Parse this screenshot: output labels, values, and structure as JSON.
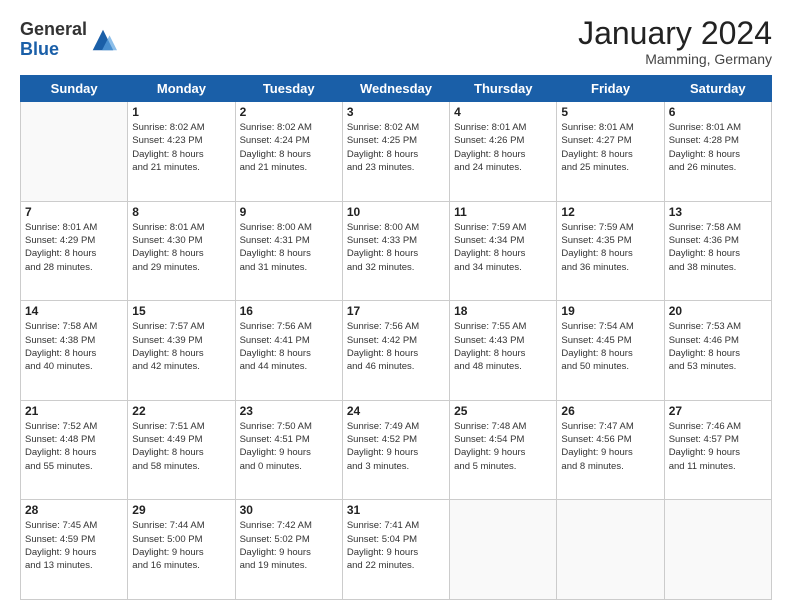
{
  "header": {
    "logo_general": "General",
    "logo_blue": "Blue",
    "month_title": "January 2024",
    "location": "Mamming, Germany"
  },
  "days_of_week": [
    "Sunday",
    "Monday",
    "Tuesday",
    "Wednesday",
    "Thursday",
    "Friday",
    "Saturday"
  ],
  "weeks": [
    [
      {
        "day": "",
        "info": ""
      },
      {
        "day": "1",
        "info": "Sunrise: 8:02 AM\nSunset: 4:23 PM\nDaylight: 8 hours\nand 21 minutes."
      },
      {
        "day": "2",
        "info": "Sunrise: 8:02 AM\nSunset: 4:24 PM\nDaylight: 8 hours\nand 21 minutes."
      },
      {
        "day": "3",
        "info": "Sunrise: 8:02 AM\nSunset: 4:25 PM\nDaylight: 8 hours\nand 23 minutes."
      },
      {
        "day": "4",
        "info": "Sunrise: 8:01 AM\nSunset: 4:26 PM\nDaylight: 8 hours\nand 24 minutes."
      },
      {
        "day": "5",
        "info": "Sunrise: 8:01 AM\nSunset: 4:27 PM\nDaylight: 8 hours\nand 25 minutes."
      },
      {
        "day": "6",
        "info": "Sunrise: 8:01 AM\nSunset: 4:28 PM\nDaylight: 8 hours\nand 26 minutes."
      }
    ],
    [
      {
        "day": "7",
        "info": "Sunrise: 8:01 AM\nSunset: 4:29 PM\nDaylight: 8 hours\nand 28 minutes."
      },
      {
        "day": "8",
        "info": "Sunrise: 8:01 AM\nSunset: 4:30 PM\nDaylight: 8 hours\nand 29 minutes."
      },
      {
        "day": "9",
        "info": "Sunrise: 8:00 AM\nSunset: 4:31 PM\nDaylight: 8 hours\nand 31 minutes."
      },
      {
        "day": "10",
        "info": "Sunrise: 8:00 AM\nSunset: 4:33 PM\nDaylight: 8 hours\nand 32 minutes."
      },
      {
        "day": "11",
        "info": "Sunrise: 7:59 AM\nSunset: 4:34 PM\nDaylight: 8 hours\nand 34 minutes."
      },
      {
        "day": "12",
        "info": "Sunrise: 7:59 AM\nSunset: 4:35 PM\nDaylight: 8 hours\nand 36 minutes."
      },
      {
        "day": "13",
        "info": "Sunrise: 7:58 AM\nSunset: 4:36 PM\nDaylight: 8 hours\nand 38 minutes."
      }
    ],
    [
      {
        "day": "14",
        "info": "Sunrise: 7:58 AM\nSunset: 4:38 PM\nDaylight: 8 hours\nand 40 minutes."
      },
      {
        "day": "15",
        "info": "Sunrise: 7:57 AM\nSunset: 4:39 PM\nDaylight: 8 hours\nand 42 minutes."
      },
      {
        "day": "16",
        "info": "Sunrise: 7:56 AM\nSunset: 4:41 PM\nDaylight: 8 hours\nand 44 minutes."
      },
      {
        "day": "17",
        "info": "Sunrise: 7:56 AM\nSunset: 4:42 PM\nDaylight: 8 hours\nand 46 minutes."
      },
      {
        "day": "18",
        "info": "Sunrise: 7:55 AM\nSunset: 4:43 PM\nDaylight: 8 hours\nand 48 minutes."
      },
      {
        "day": "19",
        "info": "Sunrise: 7:54 AM\nSunset: 4:45 PM\nDaylight: 8 hours\nand 50 minutes."
      },
      {
        "day": "20",
        "info": "Sunrise: 7:53 AM\nSunset: 4:46 PM\nDaylight: 8 hours\nand 53 minutes."
      }
    ],
    [
      {
        "day": "21",
        "info": "Sunrise: 7:52 AM\nSunset: 4:48 PM\nDaylight: 8 hours\nand 55 minutes."
      },
      {
        "day": "22",
        "info": "Sunrise: 7:51 AM\nSunset: 4:49 PM\nDaylight: 8 hours\nand 58 minutes."
      },
      {
        "day": "23",
        "info": "Sunrise: 7:50 AM\nSunset: 4:51 PM\nDaylight: 9 hours\nand 0 minutes."
      },
      {
        "day": "24",
        "info": "Sunrise: 7:49 AM\nSunset: 4:52 PM\nDaylight: 9 hours\nand 3 minutes."
      },
      {
        "day": "25",
        "info": "Sunrise: 7:48 AM\nSunset: 4:54 PM\nDaylight: 9 hours\nand 5 minutes."
      },
      {
        "day": "26",
        "info": "Sunrise: 7:47 AM\nSunset: 4:56 PM\nDaylight: 9 hours\nand 8 minutes."
      },
      {
        "day": "27",
        "info": "Sunrise: 7:46 AM\nSunset: 4:57 PM\nDaylight: 9 hours\nand 11 minutes."
      }
    ],
    [
      {
        "day": "28",
        "info": "Sunrise: 7:45 AM\nSunset: 4:59 PM\nDaylight: 9 hours\nand 13 minutes."
      },
      {
        "day": "29",
        "info": "Sunrise: 7:44 AM\nSunset: 5:00 PM\nDaylight: 9 hours\nand 16 minutes."
      },
      {
        "day": "30",
        "info": "Sunrise: 7:42 AM\nSunset: 5:02 PM\nDaylight: 9 hours\nand 19 minutes."
      },
      {
        "day": "31",
        "info": "Sunrise: 7:41 AM\nSunset: 5:04 PM\nDaylight: 9 hours\nand 22 minutes."
      },
      {
        "day": "",
        "info": ""
      },
      {
        "day": "",
        "info": ""
      },
      {
        "day": "",
        "info": ""
      }
    ]
  ]
}
